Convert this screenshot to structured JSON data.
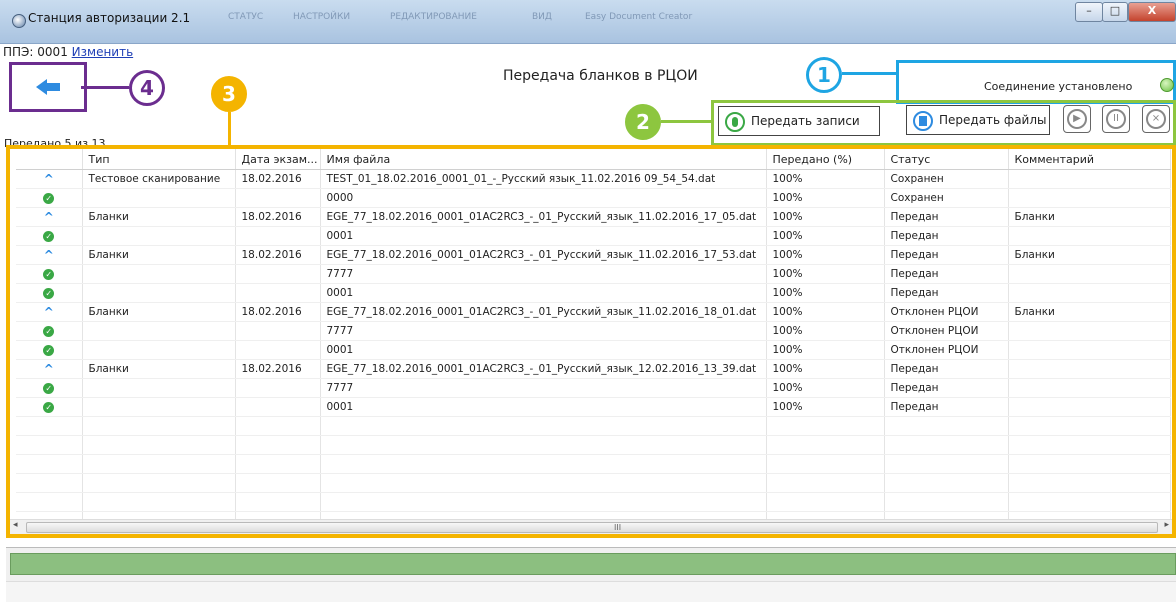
{
  "window": {
    "title": "Станция авторизации 2.1",
    "ghost_tabs": [
      "СТАТУС",
      "НАСТРОЙКИ",
      "РЕДАКТИРОВАНИЕ",
      "ВИД",
      "Easy Document Creator"
    ],
    "minimize_label": "–",
    "maximize_label": "□",
    "close_label": "X"
  },
  "ppe": {
    "label": "ППЭ: 0001",
    "change_link": "Изменить"
  },
  "page_title": "Передача бланков в РЦОИ",
  "connection": {
    "status": "Соединение установлено",
    "led_color": "#6bc144"
  },
  "toolbar": {
    "send_records": "Передать записи",
    "send_files": "Передать файлы"
  },
  "sent_count": "Передано 5 из 13",
  "annotations": {
    "n1": "1",
    "n2": "2",
    "n3": "3",
    "n4": "4"
  },
  "table": {
    "columns": [
      "",
      "Тип",
      "Дата экзам...",
      "Имя файла",
      "Передано (%)",
      "Статус",
      "Комментарий"
    ],
    "rows": [
      {
        "kind": "parent",
        "type": "Тестовое сканирование",
        "date": "18.02.2016",
        "file": "TEST_01_18.02.2016_0001_01_-_Русский язык_11.02.2016 09_54_54.dat",
        "pct": "100%",
        "status": "Сохранен",
        "comment": ""
      },
      {
        "kind": "child",
        "type": "",
        "date": "",
        "file": "0000",
        "pct": "100%",
        "status": "Сохранен",
        "comment": ""
      },
      {
        "kind": "parent",
        "type": "Бланки",
        "date": "18.02.2016",
        "file": "EGE_77_18.02.2016_0001_01AC2RC3_-_01_Русский_язык_11.02.2016_17_05.dat",
        "pct": "100%",
        "status": "Передан",
        "comment": "Бланки"
      },
      {
        "kind": "child",
        "type": "",
        "date": "",
        "file": "0001",
        "pct": "100%",
        "status": "Передан",
        "comment": ""
      },
      {
        "kind": "parent",
        "type": "Бланки",
        "date": "18.02.2016",
        "file": "EGE_77_18.02.2016_0001_01AC2RC3_-_01_Русский_язык_11.02.2016_17_53.dat",
        "pct": "100%",
        "status": "Передан",
        "comment": "Бланки"
      },
      {
        "kind": "child",
        "type": "",
        "date": "",
        "file": "7777",
        "pct": "100%",
        "status": "Передан",
        "comment": ""
      },
      {
        "kind": "child",
        "type": "",
        "date": "",
        "file": "0001",
        "pct": "100%",
        "status": "Передан",
        "comment": ""
      },
      {
        "kind": "parent",
        "type": "Бланки",
        "date": "18.02.2016",
        "file": "EGE_77_18.02.2016_0001_01AC2RC3_-_01_Русский_язык_11.02.2016_18_01.dat",
        "pct": "100%",
        "status": "Отклонен РЦОИ",
        "comment": "Бланки"
      },
      {
        "kind": "child",
        "type": "",
        "date": "",
        "file": "7777",
        "pct": "100%",
        "status": "Отклонен РЦОИ",
        "comment": ""
      },
      {
        "kind": "child",
        "type": "",
        "date": "",
        "file": "0001",
        "pct": "100%",
        "status": "Отклонен РЦОИ",
        "comment": ""
      },
      {
        "kind": "parent",
        "type": "Бланки",
        "date": "18.02.2016",
        "file": "EGE_77_18.02.2016_0001_01AC2RC3_-_01_Русский_язык_12.02.2016_13_39.dat",
        "pct": "100%",
        "status": "Передан",
        "comment": ""
      },
      {
        "kind": "child",
        "type": "",
        "date": "",
        "file": "7777",
        "pct": "100%",
        "status": "Передан",
        "comment": ""
      },
      {
        "kind": "child",
        "type": "",
        "date": "",
        "file": "0001",
        "pct": "100%",
        "status": "Передан",
        "comment": ""
      }
    ],
    "empty_rows": 6
  },
  "scrollbar": {
    "left": "◂",
    "right": "▸",
    "grip": "III"
  },
  "progress_fraction": 1.0,
  "colors": {
    "annotation_blue": "#1ea5e3",
    "annotation_green": "#8dc63f",
    "annotation_yellow": "#f4b400",
    "annotation_purple": "#6b2d8f",
    "progress": "#8cbf80"
  }
}
